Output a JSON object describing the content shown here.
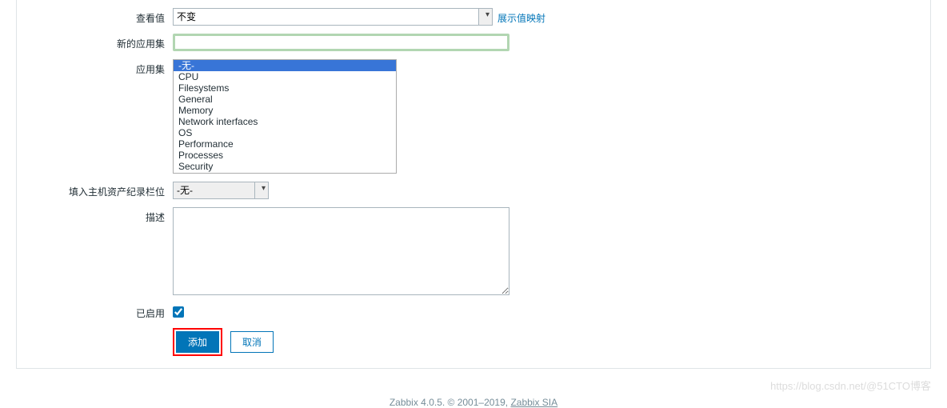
{
  "form": {
    "view_values": {
      "label": "查看值",
      "selected": "不变",
      "show_mapping_link": "展示值映射"
    },
    "new_app": {
      "label": "新的应用集",
      "value": ""
    },
    "applications": {
      "label": "应用集",
      "options": [
        "-无-",
        "CPU",
        "Filesystems",
        "General",
        "Memory",
        "Network interfaces",
        "OS",
        "Performance",
        "Processes",
        "Security"
      ],
      "selected_index": 0
    },
    "inventory": {
      "label": "填入主机资产纪录栏位",
      "selected": "-无-"
    },
    "description": {
      "label": "描述",
      "value": ""
    },
    "enabled": {
      "label": "已启用",
      "checked": true
    },
    "buttons": {
      "add": "添加",
      "cancel": "取消"
    }
  },
  "footer": {
    "text_prefix": "Zabbix 4.0.5. © 2001–2019, ",
    "link_text": "Zabbix SIA"
  },
  "watermark": "https://blog.csdn.net/@51CTO博客"
}
